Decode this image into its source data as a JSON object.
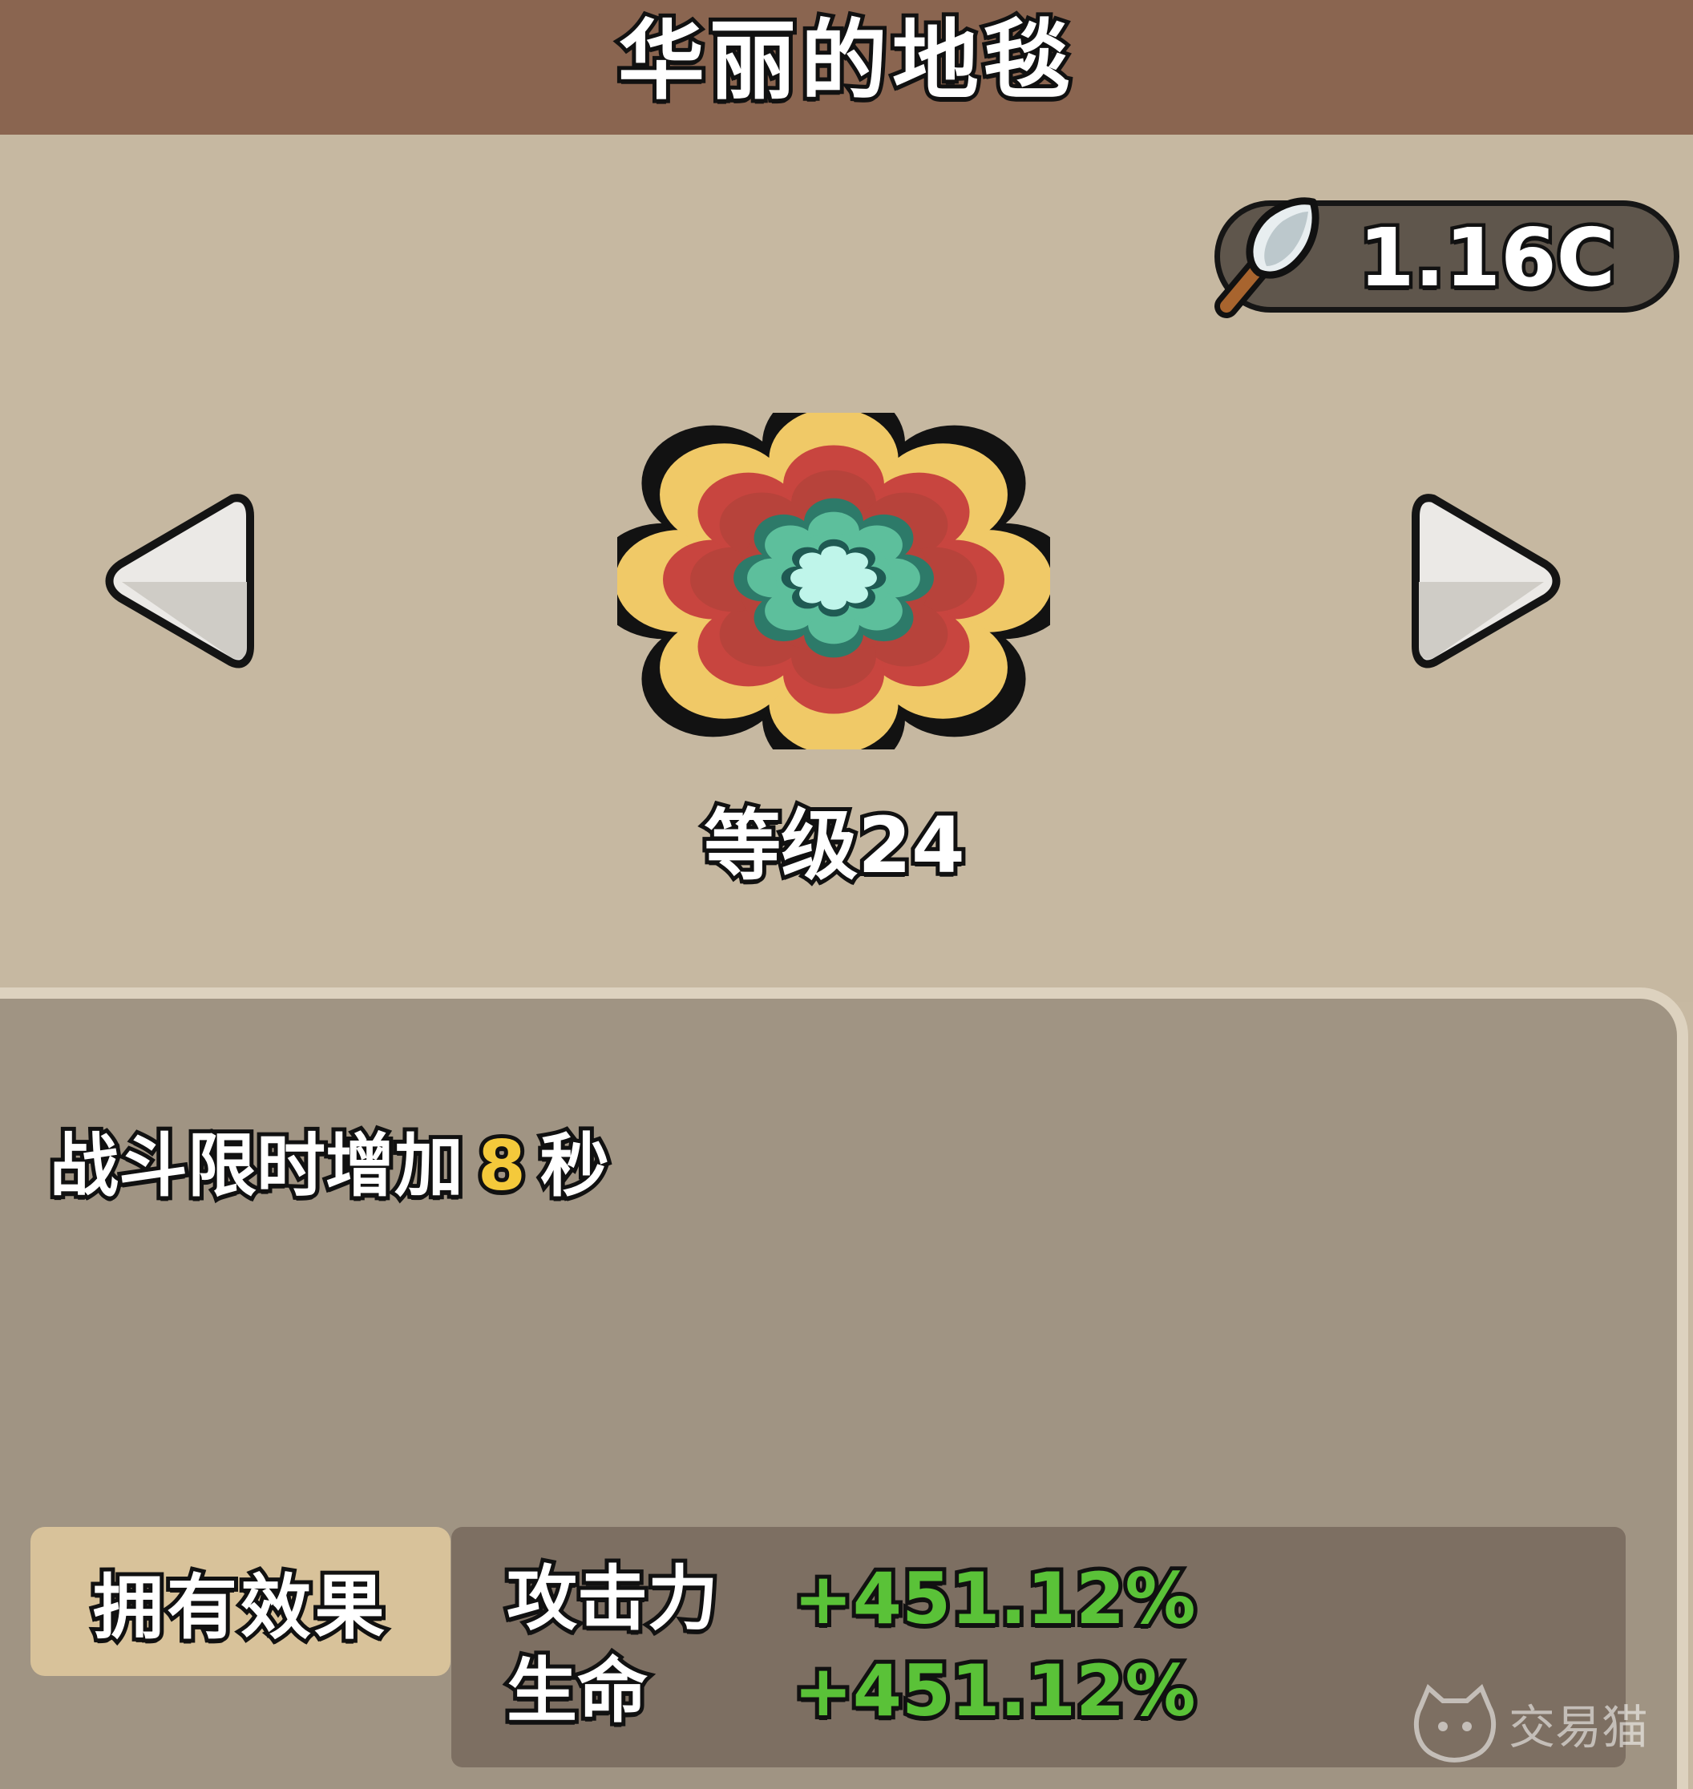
{
  "header": {
    "title": "华丽的地毯"
  },
  "currency": {
    "icon": "shovel-icon",
    "value": "1.16C"
  },
  "navigation": {
    "prev_icon": "arrow-left-icon",
    "next_icon": "arrow-right-icon"
  },
  "item": {
    "icon": "carpet-icon",
    "level_label": "等级24"
  },
  "description": {
    "prefix": "战斗限时增加",
    "value": "8",
    "suffix": "秒"
  },
  "effects": {
    "tab_label": "拥有效果",
    "stats": [
      {
        "label": "攻击力",
        "value": "+451.12%"
      },
      {
        "label": "生命",
        "value": "+451.12%"
      }
    ]
  },
  "watermark": {
    "text": "交易猫"
  },
  "colors": {
    "header_bg": "#8a6550",
    "top_bg": "#c6b8a1",
    "panel_bg": "#a09483",
    "highlight": "#f4c93b",
    "stat_green": "#5ac238",
    "tab_bg": "#d8c29a"
  }
}
